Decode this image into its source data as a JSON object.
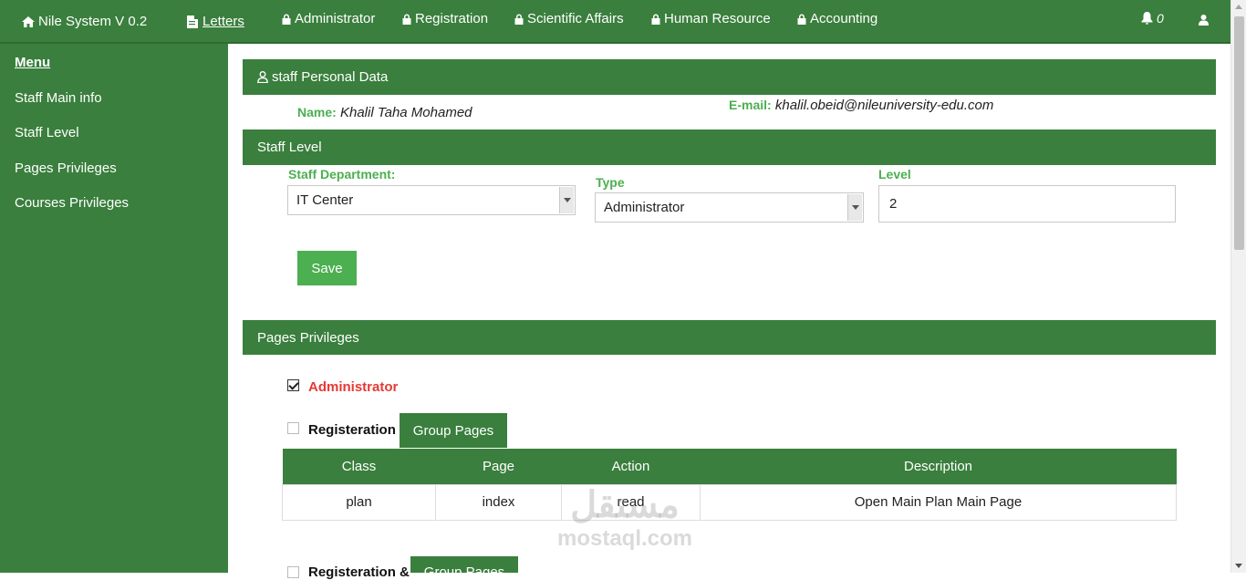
{
  "nav": {
    "brand": "Nile System V 0.2",
    "letters": "Letters",
    "items": [
      "Administrator",
      "Registration",
      "Scientific Affairs",
      "Human Resource",
      "Accounting"
    ],
    "notifications_count": "0"
  },
  "sidebar": {
    "title": "Menu",
    "items": [
      "Staff Main info",
      "Staff Level",
      "Pages Privileges",
      "Courses Privileges"
    ]
  },
  "personal": {
    "header": "staff Personal Data",
    "name_label": "Name:",
    "name_value": "Khalil Taha Mohamed",
    "email_label": "E-mail:",
    "email_value": "khalil.obeid@nileuniversity-edu.com"
  },
  "staff_level": {
    "header": "Staff Level",
    "department_label": "Staff Department:",
    "department_value": "IT Center",
    "type_label": "Type",
    "type_value": "Administrator",
    "level_label": "Level",
    "level_value": "2",
    "save_label": "Save"
  },
  "privileges": {
    "header": "Pages Privileges",
    "groups": [
      {
        "label": "Administrator",
        "checked": true
      },
      {
        "label": "Registeration",
        "checked": false,
        "button": "Group Pages"
      },
      {
        "label": "Registeration &",
        "checked": false,
        "button": "Group Pages"
      }
    ],
    "table": {
      "columns": [
        "Class",
        "Page",
        "Action",
        "Description"
      ],
      "rows": [
        [
          "plan",
          "index",
          "read",
          "Open Main Plan Main Page"
        ]
      ]
    }
  },
  "watermark": {
    "arabic": "مستقل",
    "latin": "mostaql.com"
  },
  "colors": {
    "primary": "#3a7f3d",
    "accent": "#4caf50",
    "danger": "#e53935"
  }
}
